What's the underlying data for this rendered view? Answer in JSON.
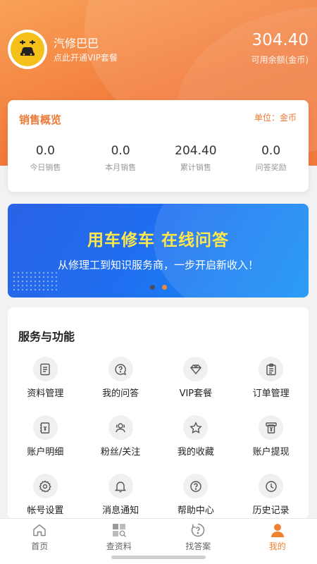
{
  "profile": {
    "name": "汽修巴巴",
    "vip_link": "点此开通VIP套餐",
    "balance": "304.40",
    "balance_label": "可用余额(金币)"
  },
  "sales": {
    "title": "销售概览",
    "unit": "单位：金币",
    "stats": [
      {
        "value": "0.0",
        "label": "今日销售"
      },
      {
        "value": "0.0",
        "label": "本月销售"
      },
      {
        "value": "204.40",
        "label": "累计销售"
      },
      {
        "value": "0.0",
        "label": "问答奖励"
      }
    ]
  },
  "banner": {
    "title": "用车修车 在线问答",
    "subtitle": "从修理工到知识服务商，一步开启新收入！",
    "active_dot": 1
  },
  "services": {
    "title": "服务与功能",
    "items": [
      {
        "label": "资料管理",
        "icon": "document-icon"
      },
      {
        "label": "我的问答",
        "icon": "question-chat-icon"
      },
      {
        "label": "VIP套餐",
        "icon": "diamond-icon"
      },
      {
        "label": "订单管理",
        "icon": "clipboard-icon"
      },
      {
        "label": "账户明细",
        "icon": "ledger-icon"
      },
      {
        "label": "粉丝/关注",
        "icon": "users-icon"
      },
      {
        "label": "我的收藏",
        "icon": "star-icon"
      },
      {
        "label": "账户提现",
        "icon": "withdraw-icon"
      },
      {
        "label": "帐号设置",
        "icon": "gear-icon"
      },
      {
        "label": "消息通知",
        "icon": "bell-icon"
      },
      {
        "label": "帮助中心",
        "icon": "help-icon"
      },
      {
        "label": "历史记录",
        "icon": "clock-icon"
      }
    ]
  },
  "tabbar": {
    "items": [
      {
        "label": "首页",
        "icon": "home-icon"
      },
      {
        "label": "查资料",
        "icon": "grid-search-icon"
      },
      {
        "label": "找答案",
        "icon": "question-icon"
      },
      {
        "label": "我的",
        "icon": "person-icon"
      }
    ],
    "active": 3
  },
  "colors": {
    "accent": "#f0812f",
    "banner_title": "#ffe94a"
  }
}
